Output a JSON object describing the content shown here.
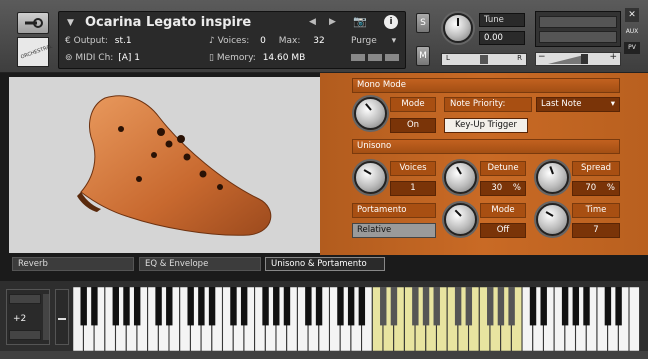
{
  "header": {
    "instrument_name": "Ocarina Legato inspire",
    "output_label": "Output:",
    "output_value": "st.1",
    "voices_label": "Voices:",
    "voices_value": "0",
    "max_label": "Max:",
    "max_value": "32",
    "midi_label": "MIDI Ch:",
    "midi_value": "[A]  1",
    "memory_label": "Memory:",
    "memory_value": "14.60 MB",
    "purge_label": "Purge",
    "solo_label": "S",
    "mute_label": "M",
    "tune_label": "Tune",
    "tune_value": "0.00",
    "pan_left": "L",
    "pan_right": "R",
    "aux_label": "AUX",
    "pv_label": "PV",
    "logo_text": "ORCHESTRAL"
  },
  "mono_mode": {
    "section_label": "Mono Mode",
    "mode_label": "Mode",
    "mode_value": "On",
    "note_priority_label": "Note Priority:",
    "note_priority_value": "Last Note",
    "key_up_trigger_label": "Key-Up Trigger"
  },
  "unisono": {
    "section_label": "Unisono",
    "voices_label": "Voices",
    "voices_value": "1",
    "detune_label": "Detune",
    "detune_value": "30",
    "detune_unit": "%",
    "spread_label": "Spread",
    "spread_value": "70",
    "spread_unit": "%"
  },
  "portamento": {
    "section_label": "Portamento",
    "mode_label": "Mode",
    "mode_value": "Off",
    "time_label": "Time",
    "time_value": "7",
    "type_value": "Relative"
  },
  "tabs": [
    {
      "label": "Reverb"
    },
    {
      "label": "EQ & Envelope"
    },
    {
      "label": "Unisono & Portamento"
    }
  ],
  "keyboard": {
    "octave_value": "+2"
  },
  "colors": {
    "panel_orange": "#c96a25",
    "highlight_keys": "#e8e4a0"
  }
}
